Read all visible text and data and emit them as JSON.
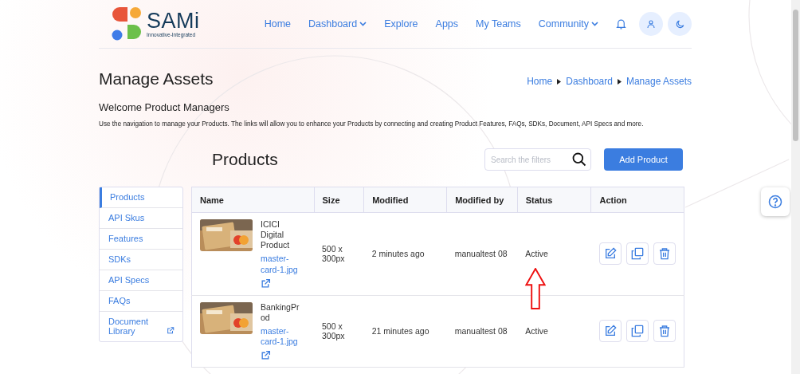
{
  "logo": {
    "name": "SAMi",
    "tagline": "Innovative-Integrated"
  },
  "nav": [
    {
      "label": "Home",
      "kind": "link"
    },
    {
      "label": "Dashboard",
      "kind": "dropdown"
    },
    {
      "label": "Explore",
      "kind": "link"
    },
    {
      "label": "Apps",
      "kind": "link"
    },
    {
      "label": "My Teams",
      "kind": "link"
    },
    {
      "label": "Community",
      "kind": "dropdown"
    }
  ],
  "page_title": "Manage Assets",
  "breadcrumb": [
    "Home",
    "Dashboard",
    "Manage Assets"
  ],
  "welcome": "Welcome Product Managers",
  "description": "Use the navigation to manage your Products. The links will allow you to enhance your Products by connecting and creating Product Features, FAQs, SDKs, Document, API Specs and more.",
  "section_title": "Products",
  "search": {
    "placeholder": "Search the filters"
  },
  "add_button": "Add Product",
  "sidebar": {
    "items": [
      {
        "label": "Products",
        "selected": true,
        "kind": "link"
      },
      {
        "label": "API Skus",
        "selected": false,
        "kind": "link"
      },
      {
        "label": "Features",
        "selected": false,
        "kind": "link"
      },
      {
        "label": "SDKs",
        "selected": false,
        "kind": "link"
      },
      {
        "label": "API Specs",
        "selected": false,
        "kind": "link"
      },
      {
        "label": "FAQs",
        "selected": false,
        "kind": "link"
      },
      {
        "label": "Document Library",
        "selected": false,
        "kind": "external"
      }
    ]
  },
  "table": {
    "columns": [
      "Name",
      "Size",
      "Modified",
      "Modified by",
      "Status",
      "Action"
    ],
    "rows": [
      {
        "name": "ICICI Digital Product",
        "file": "master-card-1.jpg",
        "size": "500 x 300px",
        "modified": "2 minutes ago",
        "modified_by": "manualtest 08",
        "status": "Active"
      },
      {
        "name": "BankingProd",
        "file": "master-card-1.jpg",
        "size": "500 x 300px",
        "modified": "21 minutes ago",
        "modified_by": "manualtest 08",
        "status": "Active"
      }
    ]
  }
}
